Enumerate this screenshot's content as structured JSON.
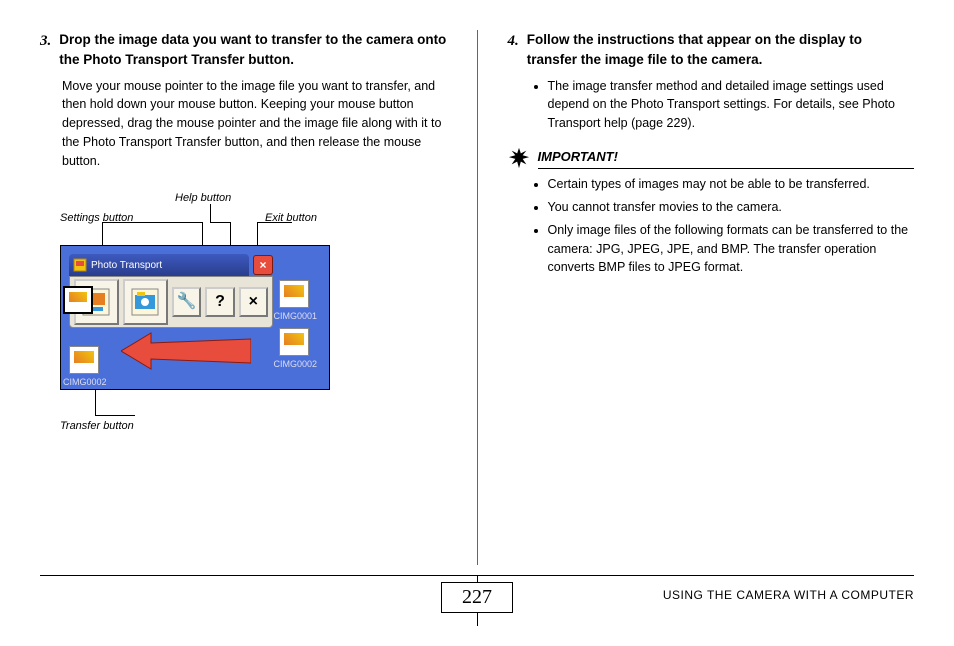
{
  "left": {
    "step_num": "3.",
    "step_title": "Drop the image data you want to transfer to the camera onto the Photo Transport Transfer button.",
    "step_body": "Move your mouse pointer to the image file you want to transfer, and then hold down your mouse button. Keeping your mouse button depressed, drag the mouse pointer and the image file along with it to the Photo Transport Transfer button, and then release the mouse button."
  },
  "diagram": {
    "callouts": {
      "settings": "Settings button",
      "help": "Help button",
      "exit": "Exit button",
      "transfer": "Transfer button"
    },
    "window_title": "Photo Transport",
    "desk_labels": [
      "CIMG0001",
      "CIMG0002",
      "CIMG0002"
    ],
    "toolbar_glyphs": {
      "settings": "🔧",
      "help": "?",
      "exit": "×"
    }
  },
  "right": {
    "step_num": "4.",
    "step_title": "Follow the instructions that appear on the display to transfer the image file to the camera.",
    "bullet1": "The image transfer method and detailed image settings used depend on the Photo Transport settings. For details, see Photo Transport help (page 229).",
    "important_label": "IMPORTANT!",
    "important_items": [
      "Certain types of images may not be able to be transferred.",
      "You cannot transfer movies to the camera.",
      "Only image files of the following formats can be transferred to the camera: JPG, JPEG, JPE, and BMP. The transfer operation converts BMP files to JPEG format."
    ]
  },
  "footer": {
    "page_number": "227",
    "section": "USING THE CAMERA WITH A COMPUTER"
  }
}
